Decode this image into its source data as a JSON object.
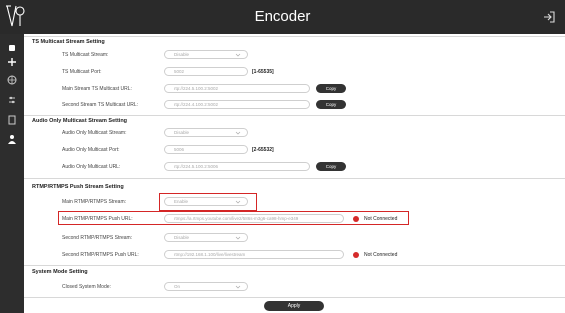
{
  "app": {
    "title": "Encoder"
  },
  "sections": {
    "ts": {
      "title": "TS Multicast Stream Setting",
      "stream_label": "TS Multicast Stream:",
      "stream_value": "Disable",
      "port_label": "TS Multicast Port:",
      "port_value": "5002",
      "port_range": "[1-65535]",
      "main_url_label": "Main Stream TS Multicast URL:",
      "main_url_value": "rtp://224.5.100.2:5002",
      "main_copy": "Copy",
      "second_url_label": "Second Stream TS Multicast URL:",
      "second_url_value": "rtp://224.4.100.2:5002",
      "second_copy": "Copy"
    },
    "audio": {
      "title": "Audio Only Multicast Stream Setting",
      "stream_label": "Audio Only Multicast Stream:",
      "stream_value": "Disable",
      "port_label": "Audio Only Multicast Port:",
      "port_value": "5006",
      "port_range": "[2-65532]",
      "url_label": "Audio Only Multicast URL:",
      "url_value": "rtp://224.5.100.2:5006",
      "copy": "Copy"
    },
    "rtmp": {
      "title": "RTMP/RTMPS Push Stream Setting",
      "main_stream_label": "Main RTMP/RTMPS Stream:",
      "main_stream_value": "Enable",
      "main_url_label": "Main RTMP/RTMPS Push URL:",
      "main_url_value": "rtmps://a.rtmps.youtube.com/live2/586s-m3g6-ca98-hmp-e349",
      "main_status": "Not Connected",
      "second_stream_label": "Second RTMP/RTMPS Stream:",
      "second_stream_value": "Disable",
      "second_url_label": "Second RTMP/RTMPS Push URL:",
      "second_url_value": "rtmp://192.168.1.100/live/livestream",
      "second_status": "Not Connected"
    },
    "system": {
      "title": "System Mode Setting",
      "closed_label": "Closed System Mode:",
      "closed_value": "On"
    }
  },
  "apply_label": "Apply",
  "colors": {
    "topbar": "#2a2a2a",
    "sidebar": "#2d2d2d",
    "status_red": "#d52b2b",
    "highlight": "#d42626"
  }
}
